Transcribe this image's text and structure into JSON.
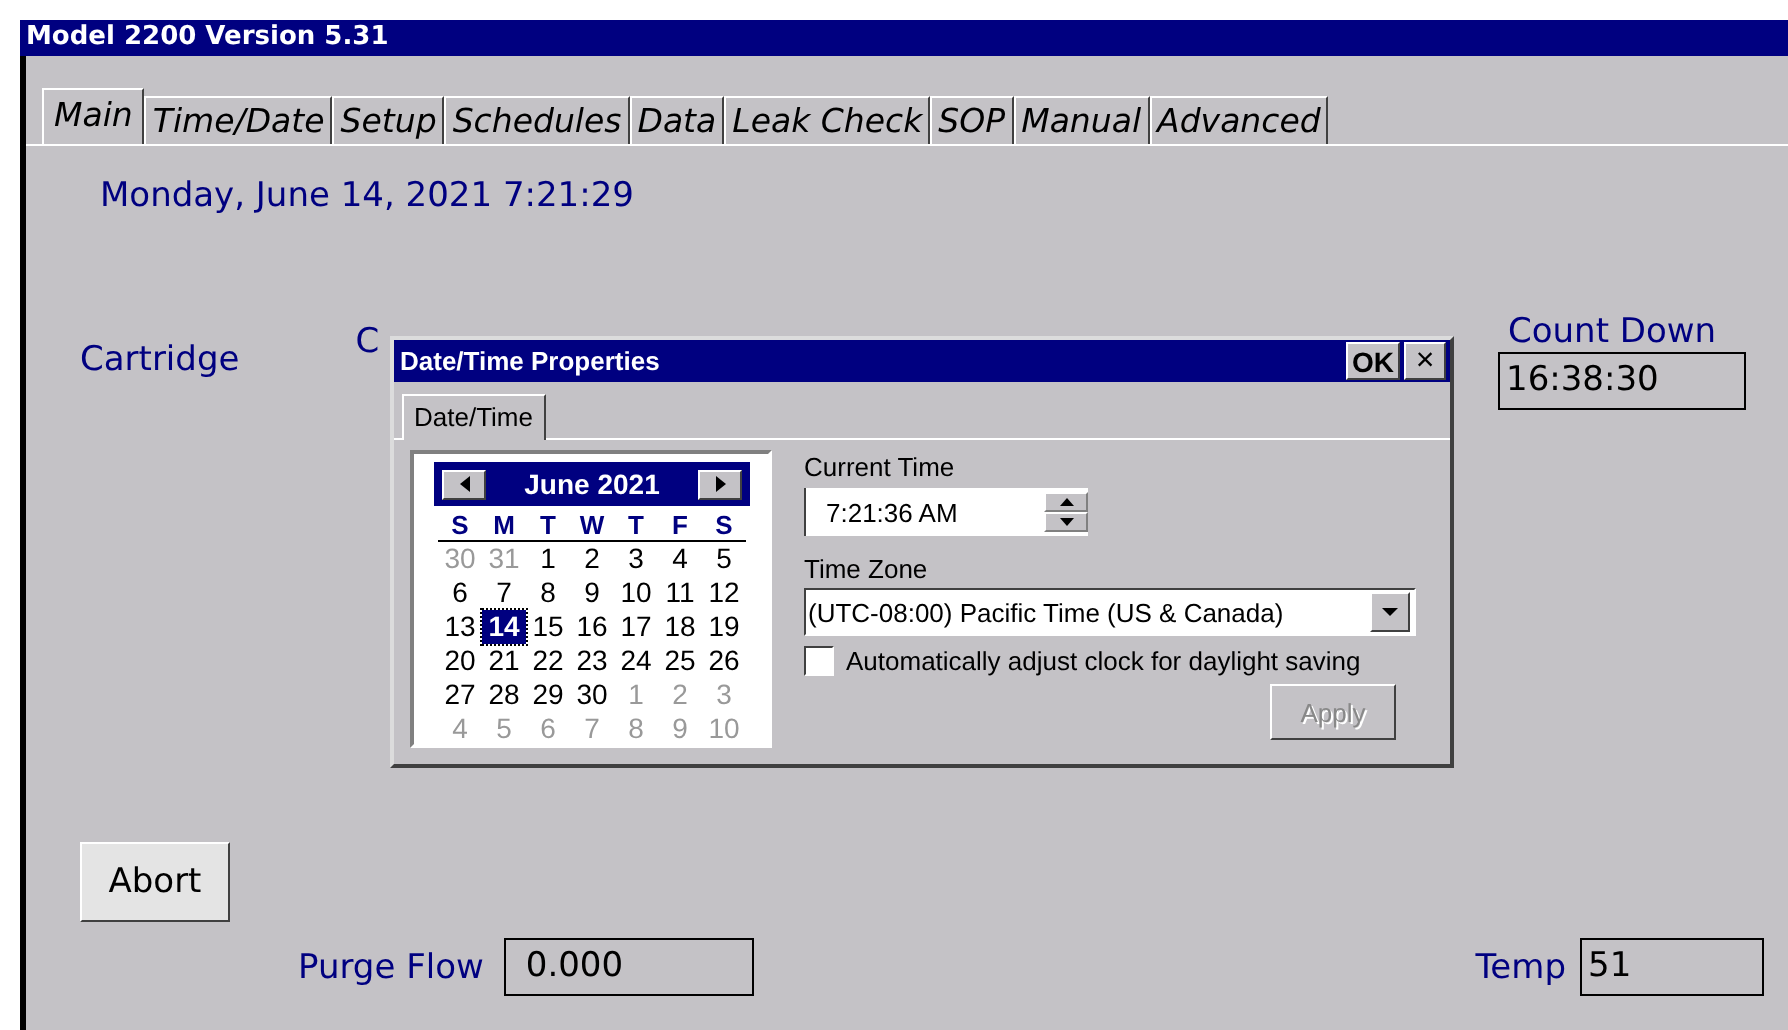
{
  "window": {
    "title": "Model 2200 Version 5.31"
  },
  "tabs": [
    {
      "label": "Main",
      "selected": true
    },
    {
      "label": "Time/Date",
      "selected": false
    },
    {
      "label": "Setup",
      "selected": false
    },
    {
      "label": "Schedules",
      "selected": false
    },
    {
      "label": "Data",
      "selected": false
    },
    {
      "label": "Leak Check",
      "selected": false
    },
    {
      "label": "SOP",
      "selected": false
    },
    {
      "label": "Manual",
      "selected": false
    },
    {
      "label": "Advanced",
      "selected": false
    }
  ],
  "main": {
    "datetime": "Monday, June 14, 2021 7:21:29",
    "cartridge_label": "Cartridge",
    "column_2_label": "C",
    "count_down": {
      "label": "Count Down",
      "value": "16:38:30"
    },
    "abort_button": "Abort",
    "purge_flow": {
      "label": "Purge Flow",
      "value": "0.000"
    },
    "temp": {
      "label": "Temp",
      "value": "51"
    }
  },
  "dialog": {
    "title": "Date/Time Properties",
    "ok_button": "OK",
    "close_button": "×",
    "tabs": [
      {
        "label": "Date/Time",
        "selected": true
      }
    ],
    "calendar": {
      "month": "June 2021",
      "weekdays": [
        "S",
        "M",
        "T",
        "W",
        "T",
        "F",
        "S"
      ],
      "weeks": [
        [
          {
            "day": "30",
            "outside": true,
            "selected": false
          },
          {
            "day": "31",
            "outside": true,
            "selected": false
          },
          {
            "day": "1",
            "outside": false,
            "selected": false
          },
          {
            "day": "2",
            "outside": false,
            "selected": false
          },
          {
            "day": "3",
            "outside": false,
            "selected": false
          },
          {
            "day": "4",
            "outside": false,
            "selected": false
          },
          {
            "day": "5",
            "outside": false,
            "selected": false
          }
        ],
        [
          {
            "day": "6",
            "outside": false,
            "selected": false
          },
          {
            "day": "7",
            "outside": false,
            "selected": false
          },
          {
            "day": "8",
            "outside": false,
            "selected": false
          },
          {
            "day": "9",
            "outside": false,
            "selected": false
          },
          {
            "day": "10",
            "outside": false,
            "selected": false
          },
          {
            "day": "11",
            "outside": false,
            "selected": false
          },
          {
            "day": "12",
            "outside": false,
            "selected": false
          }
        ],
        [
          {
            "day": "13",
            "outside": false,
            "selected": false
          },
          {
            "day": "14",
            "outside": false,
            "selected": true
          },
          {
            "day": "15",
            "outside": false,
            "selected": false
          },
          {
            "day": "16",
            "outside": false,
            "selected": false
          },
          {
            "day": "17",
            "outside": false,
            "selected": false
          },
          {
            "day": "18",
            "outside": false,
            "selected": false
          },
          {
            "day": "19",
            "outside": false,
            "selected": false
          }
        ],
        [
          {
            "day": "20",
            "outside": false,
            "selected": false
          },
          {
            "day": "21",
            "outside": false,
            "selected": false
          },
          {
            "day": "22",
            "outside": false,
            "selected": false
          },
          {
            "day": "23",
            "outside": false,
            "selected": false
          },
          {
            "day": "24",
            "outside": false,
            "selected": false
          },
          {
            "day": "25",
            "outside": false,
            "selected": false
          },
          {
            "day": "26",
            "outside": false,
            "selected": false
          }
        ],
        [
          {
            "day": "27",
            "outside": false,
            "selected": false
          },
          {
            "day": "28",
            "outside": false,
            "selected": false
          },
          {
            "day": "29",
            "outside": false,
            "selected": false
          },
          {
            "day": "30",
            "outside": false,
            "selected": false
          },
          {
            "day": "1",
            "outside": true,
            "selected": false
          },
          {
            "day": "2",
            "outside": true,
            "selected": false
          },
          {
            "day": "3",
            "outside": true,
            "selected": false
          }
        ],
        [
          {
            "day": "4",
            "outside": true,
            "selected": false
          },
          {
            "day": "5",
            "outside": true,
            "selected": false
          },
          {
            "day": "6",
            "outside": true,
            "selected": false
          },
          {
            "day": "7",
            "outside": true,
            "selected": false
          },
          {
            "day": "8",
            "outside": true,
            "selected": false
          },
          {
            "day": "9",
            "outside": true,
            "selected": false
          },
          {
            "day": "10",
            "outside": true,
            "selected": false
          }
        ]
      ]
    },
    "current_time": {
      "label": "Current Time",
      "value": "7:21:36 AM"
    },
    "time_zone": {
      "label": "Time Zone",
      "value": "(UTC-08:00) Pacific Time (US & Canada)"
    },
    "daylight_checkbox": {
      "label": "Automatically adjust clock for daylight saving",
      "checked": false
    },
    "apply_button": {
      "label": "Apply",
      "disabled": true
    }
  }
}
